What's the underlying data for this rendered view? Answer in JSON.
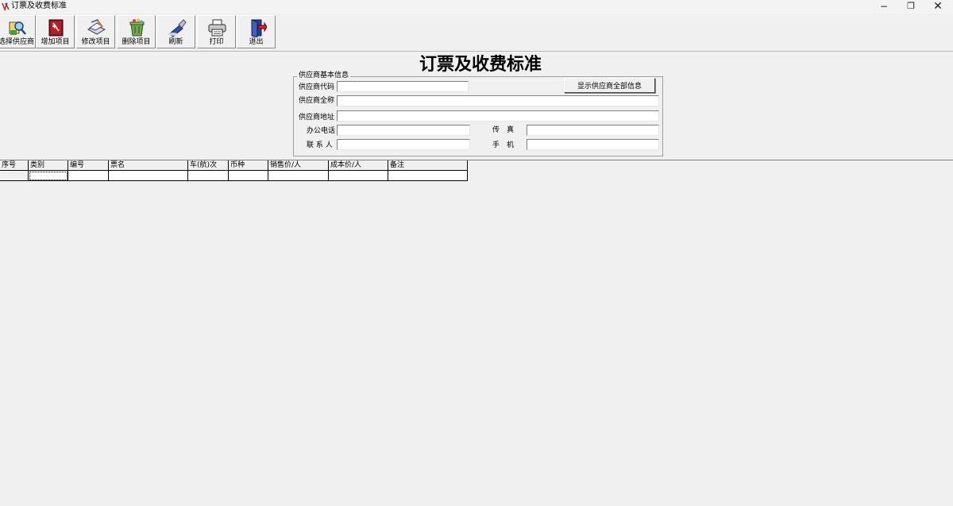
{
  "window": {
    "title": "订票及收费标准",
    "minimize_glyph": "−",
    "maximize_glyph": "❐",
    "close_glyph": "✕"
  },
  "toolbar": {
    "buttons": [
      {
        "label": "选择供应商",
        "icon": "select-supplier-icon"
      },
      {
        "label": "增加项目",
        "icon": "add-item-icon"
      },
      {
        "label": "修改项目",
        "icon": "edit-item-icon"
      },
      {
        "label": "删除项目",
        "icon": "delete-item-icon"
      },
      {
        "label": "刷新",
        "icon": "refresh-icon"
      },
      {
        "label": "打印",
        "icon": "printer-icon"
      },
      {
        "label": "退出",
        "icon": "exit-icon"
      }
    ]
  },
  "form": {
    "title": "订票及收费标准",
    "group_label": "供应商基本信息",
    "show_all_button": "显示供应商全部信息",
    "fields": {
      "code": {
        "label": "供应商代码",
        "value": ""
      },
      "fullname": {
        "label": "供应商全称",
        "value": ""
      },
      "address": {
        "label": "供应商地址",
        "value": ""
      },
      "phone": {
        "label": "办公电话",
        "value": ""
      },
      "fax": {
        "label": "传　真",
        "value": ""
      },
      "contact": {
        "label": "联 系 人",
        "value": ""
      },
      "mobile": {
        "label": "手　机",
        "value": ""
      }
    }
  },
  "grid": {
    "columns": [
      "序号",
      "类别",
      "编号",
      "票名",
      "车(航)次",
      "币种",
      "销售价/人",
      "成本价/人",
      "备注"
    ],
    "rows": [
      [
        "",
        "",
        "",
        "",
        "",
        "",
        "",
        "",
        ""
      ]
    ]
  },
  "colors": {
    "background": "#f0f0f0",
    "field_bg": "#ffffff",
    "border": "#808080"
  }
}
